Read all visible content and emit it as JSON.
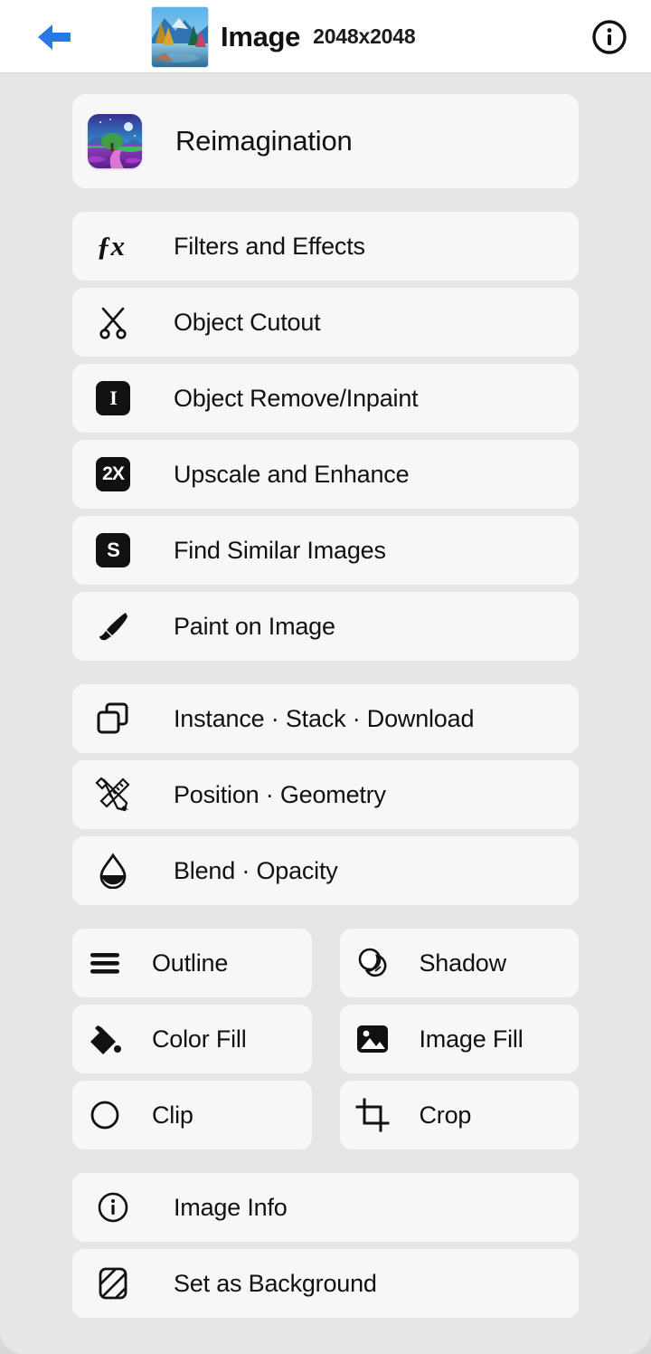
{
  "header": {
    "back_icon": "arrow-left-icon",
    "thumbnail_alt": "mountain-lake-painting-thumbnail",
    "title": "Image",
    "dimensions": "2048x2048",
    "info_icon": "info-circle-icon",
    "accent_color": "#2878e6",
    "background": "#ffffff"
  },
  "theme": {
    "page_background": "#e7e5e7",
    "card_background": "#f7f7f9",
    "text_color": "#111111",
    "icon_color": "#111111"
  },
  "groups": [
    {
      "name": "feature-hero",
      "items": [
        {
          "label": "Reimagination",
          "icon": "reimagination-thumbnail",
          "type": "thumb"
        }
      ]
    },
    {
      "name": "ai-tools",
      "items": [
        {
          "label": "Filters and Effects",
          "icon": "fx-icon"
        },
        {
          "label": "Object Cutout",
          "icon": "scissors-icon"
        },
        {
          "label": "Object Remove/Inpaint",
          "icon": "inpaint-badge-icon"
        },
        {
          "label": "Upscale and Enhance",
          "icon": "upscale-2x-badge-icon"
        },
        {
          "label": "Find Similar Images",
          "icon": "similar-s-badge-icon"
        },
        {
          "label": "Paint on Image",
          "icon": "paintbrush-icon"
        }
      ]
    },
    {
      "name": "object-tools",
      "items": [
        {
          "label": "Instance · Stack · Download",
          "icon": "copy-stack-icon"
        },
        {
          "label": "Position · Geometry",
          "icon": "ruler-pencil-icon"
        },
        {
          "label": "Blend · Opacity",
          "icon": "droplet-half-icon"
        }
      ]
    },
    {
      "name": "style-grid",
      "layout": "two-column",
      "items": [
        {
          "label": "Outline",
          "icon": "lines-stack-icon"
        },
        {
          "label": "Shadow",
          "icon": "shadow-circles-icon"
        },
        {
          "label": "Color Fill",
          "icon": "paint-bucket-icon"
        },
        {
          "label": "Image Fill",
          "icon": "image-icon"
        },
        {
          "label": "Clip",
          "icon": "circle-icon"
        },
        {
          "label": "Crop",
          "icon": "crop-icon"
        }
      ]
    },
    {
      "name": "meta-actions",
      "items": [
        {
          "label": "Image Info",
          "icon": "info-circle-icon"
        },
        {
          "label": "Set as Background",
          "icon": "hatched-square-icon"
        }
      ]
    }
  ],
  "badge_text": {
    "inpaint": "I",
    "upscale": "2X",
    "similar": "S"
  }
}
